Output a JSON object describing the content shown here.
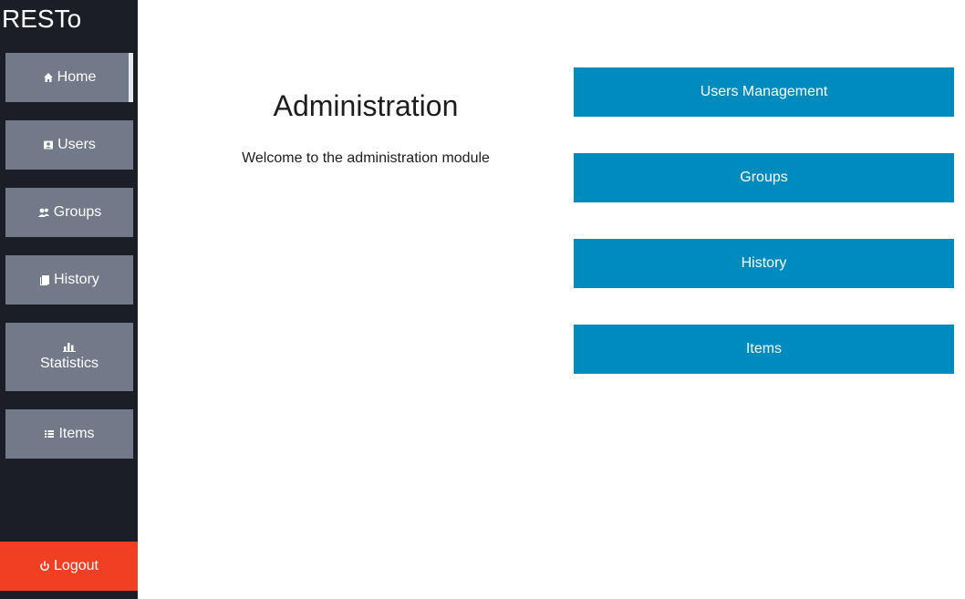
{
  "app": {
    "brand": "RESTo"
  },
  "sidebar": {
    "items": [
      {
        "label": "Home",
        "icon": "home-icon",
        "active": true
      },
      {
        "label": "Users",
        "icon": "user-card-icon"
      },
      {
        "label": "Groups",
        "icon": "users-icon"
      },
      {
        "label": "History",
        "icon": "book-icon"
      },
      {
        "label": "Statistics",
        "icon": "bar-chart-icon"
      },
      {
        "label": "Items",
        "icon": "list-icon"
      }
    ],
    "logout": {
      "label": "Logout",
      "icon": "power-icon"
    }
  },
  "main": {
    "title": "Administration",
    "subtitle": "Welcome to the administration module"
  },
  "actions": [
    {
      "label": "Users Management"
    },
    {
      "label": "Groups"
    },
    {
      "label": "History"
    },
    {
      "label": "Items"
    }
  ],
  "colors": {
    "sidebar_bg": "#1b1e27",
    "nav_item_bg": "#727a8a",
    "logout_bg": "#f03f23",
    "action_bg": "#008bbf"
  }
}
